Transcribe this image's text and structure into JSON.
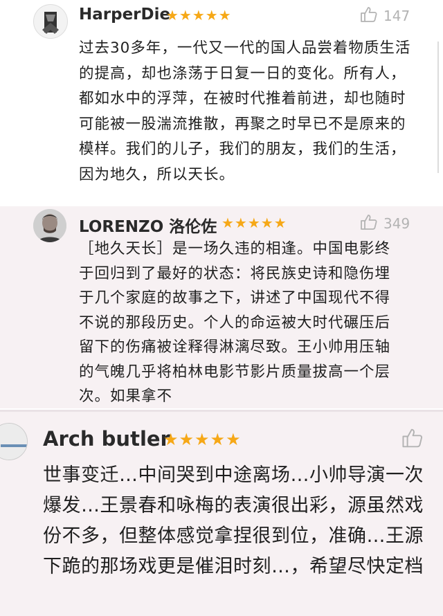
{
  "reviews": [
    {
      "username": "HarperDie",
      "stars": "★★★★★",
      "likes": "147",
      "text": "过去30多年，一代又一代的国人品尝着物质生活的提高，却也涤荡于日复一日的变化。所有人，都如水中的浮萍，在被时代推着前进，却也随时可能被一股湍流推散，再聚之时早已不是原来的模样。我们的儿子，我们的朋友，我们的生活，因为地久，所以天长。"
    },
    {
      "username": "LORENZO 洛伦佐",
      "stars": "★★★★★",
      "likes": "349",
      "text": "［地久天长］是一场久违的相逢。中国电影终于回归到了最好的状态：将民族史诗和隐伤埋于几个家庭的故事之下，讲述了中国现代不得不说的那段历史。个人的命运被大时代碾压后留下的伤痛被诠释得淋漓尽致。王小帅用压轴的气魄几乎将柏林电影节影片质量拔高一个层次。如果拿不"
    },
    {
      "username": "Arch butler",
      "stars": "★★★★★",
      "text": "世事变迁…中间哭到中途离场…小帅导演一次爆发…王景春和咏梅的表演很出彩，源虽然戏份不多，但整体感觉拿捏很到位，准确…王源下跪的那场戏更是催泪时刻…，希望尽快定档"
    }
  ],
  "colors": {
    "star": "#f6a817",
    "like": "#b3b3b3",
    "card_pink": "#f7f1f3"
  },
  "icons": {
    "like": "thumbs-up-icon"
  }
}
